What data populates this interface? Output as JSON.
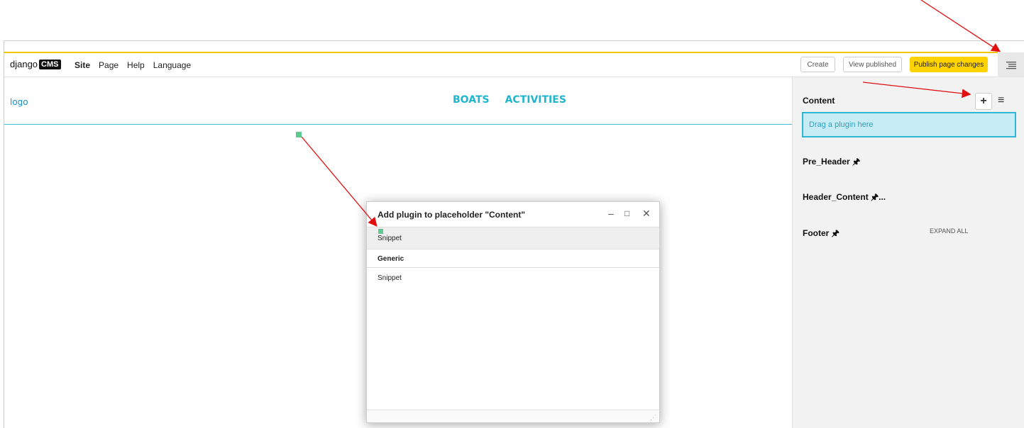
{
  "toolbar": {
    "logo_text": "django",
    "logo_badge": "CMS",
    "menu": [
      "Site",
      "Page",
      "Help",
      "Language"
    ],
    "create_label": "Create",
    "view_published_label": "View published",
    "publish_label": "Publish page changes"
  },
  "site": {
    "logo": "logo",
    "nav": [
      "BOATS",
      "ACTIVITIES"
    ]
  },
  "sidebar": {
    "content_title": "Content",
    "drop_text": "Drag a plugin here",
    "placeholders": [
      "Pre_Header",
      "Header_Content",
      "Footer"
    ],
    "header_content_suffix": "...",
    "expand_all": "EXPAND ALL",
    "pin_icon": "pin-icon"
  },
  "modal": {
    "title": "Add plugin to placeholder \"Content\"",
    "highlight_item": "Snippet",
    "group_label": "Generic",
    "items": [
      "Snippet"
    ]
  },
  "colors": {
    "accent_yellow": "#ffd300",
    "link_cyan": "#1fb5cf",
    "annotation_red": "#e01010"
  }
}
